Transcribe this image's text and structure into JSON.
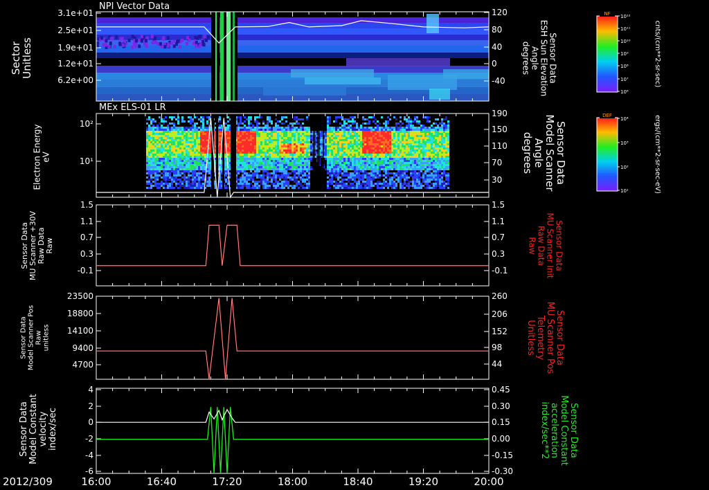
{
  "colors": {
    "background": "#000000",
    "axis": "#ffffff",
    "red_trace": "#ff2020",
    "green_trace": "#22ee22"
  },
  "time_axis": {
    "date_label": "2012/309",
    "ticks": [
      "16:00",
      "16:40",
      "17:20",
      "18:00",
      "18:40",
      "19:20",
      "20:00"
    ]
  },
  "colorbars": [
    {
      "label": "NF",
      "units": "cnts/(cm**2-sr-sec)",
      "ticks": [
        "10¹²",
        "10¹¹",
        "10¹⁰",
        "10⁹",
        "10⁸",
        "10⁷",
        "10⁶"
      ]
    },
    {
      "label": "DEF",
      "units": "ergs/(cm**2-sr-sec-eV)",
      "ticks": [
        "10⁴",
        "10³",
        "10²",
        "10¹"
      ]
    }
  ],
  "chart_data": [
    {
      "type": "heatmap",
      "title": "NPI Vector Data",
      "ylabel": [
        "Sector",
        "Unitless"
      ],
      "yticks": [
        "3.1e+01",
        "2.5e+01",
        "1.9e+01",
        "1.2e+01",
        "6.2e+00"
      ],
      "right_ylabel": [
        "Sensor Data",
        "ESH Sun Elevation",
        "Angle",
        "degrees"
      ],
      "right_yticks": [
        "120",
        "80",
        "40",
        "0",
        "-40"
      ],
      "right_ylim": [
        -80,
        120
      ],
      "overlay_line": {
        "x": [
          "16:00",
          "17:06",
          "17:15",
          "17:25",
          "17:45",
          "17:58",
          "18:10",
          "18:30",
          "18:42",
          "19:00",
          "19:20",
          "19:45",
          "20:00"
        ],
        "y": [
          86,
          86,
          50,
          86,
          87,
          96,
          86,
          89,
          100,
          94,
          86,
          84,
          86
        ]
      }
    },
    {
      "type": "heatmap",
      "title": "MEx ELS-01 LR",
      "ylabel": [
        "Electron Energy",
        "eV"
      ],
      "yticks": [
        "10²",
        "10¹"
      ],
      "right_ylabel": [
        "Sensor Data",
        "Model Scanner",
        "Angle",
        "degrees"
      ],
      "right_yticks": [
        "190",
        "150",
        "110",
        "70",
        "30"
      ],
      "right_ylim": [
        0,
        190
      ],
      "overlay_line": {
        "x": [
          "16:00",
          "17:06",
          "17:10",
          "17:14",
          "17:18",
          "17:22",
          "17:24",
          "20:00"
        ],
        "y": [
          11,
          11,
          180,
          0,
          180,
          0,
          11,
          11
        ]
      }
    },
    {
      "type": "line",
      "ylabel": [
        "Sensor Data",
        "MU Scanner +30V",
        "Raw Data",
        "Raw"
      ],
      "yticks": [
        "1.5",
        "1.1",
        "0.7",
        "0.3",
        "-0.1"
      ],
      "ylim": [
        -0.5,
        1.5
      ],
      "right_ylabel": [
        "Sensor Data",
        "MU Scanner Init",
        "Raw Data",
        "Raw"
      ],
      "right_yticks": [
        "1.5",
        "1.1",
        "0.7",
        "0.3",
        "-0.1"
      ],
      "series": [
        {
          "x": [
            "16:00",
            "17:07",
            "17:09",
            "17:15",
            "17:17",
            "17:20",
            "17:22",
            "17:26",
            "17:28",
            "20:00"
          ],
          "y": [
            0,
            0,
            1,
            1,
            0,
            1,
            1,
            1,
            0,
            0
          ]
        }
      ]
    },
    {
      "type": "line",
      "ylabel": [
        "Sensor Data",
        "Model Scanner Pos",
        "Raw",
        "unitless"
      ],
      "yticks": [
        "23500",
        "18800",
        "14100",
        "9400",
        "4700"
      ],
      "ylim": [
        0,
        23500
      ],
      "right_ylabel": [
        "Sensor Data",
        "MU Scanner Pos",
        "Telemetry",
        "Unitless"
      ],
      "right_yticks": [
        "260",
        "206",
        "152",
        "98",
        "44"
      ],
      "series": [
        {
          "x": [
            "16:00",
            "17:07",
            "17:09",
            "17:15",
            "17:19",
            "17:23",
            "17:26",
            "20:00"
          ],
          "y": [
            8000,
            8000,
            0,
            23000,
            0,
            23000,
            8000,
            8000
          ]
        }
      ]
    },
    {
      "type": "line",
      "ylabel": [
        "Sensor Data",
        "Model Constant",
        "velocity",
        "index/sec"
      ],
      "yticks": [
        "4",
        "2",
        "0",
        "-2",
        "-4",
        "-6"
      ],
      "ylim": [
        -6,
        4
      ],
      "right_ylabel": [
        "Sensor Data",
        "Model Constant",
        "acceleration",
        "index/sec**2"
      ],
      "right_yticks": [
        "0.45",
        "0.30",
        "0.15",
        "0.00",
        "-0.15",
        "-0.30"
      ],
      "series": [
        {
          "x": [
            "16:00",
            "17:07",
            "17:09",
            "17:12",
            "17:15",
            "17:17",
            "17:20",
            "17:23",
            "17:25",
            "20:00"
          ],
          "y": [
            0,
            0,
            1.2,
            0.4,
            1.4,
            0.3,
            1.5,
            0.5,
            0,
            0
          ]
        },
        {
          "x": [
            "16:00",
            "17:08",
            "17:10",
            "17:12",
            "17:14",
            "17:16",
            "17:18",
            "17:20",
            "17:22",
            "17:24",
            "20:00"
          ],
          "y": [
            -2,
            -2,
            1.8,
            -6,
            1.8,
            -6,
            1.8,
            -6,
            1.8,
            -2,
            -2
          ]
        }
      ]
    }
  ]
}
